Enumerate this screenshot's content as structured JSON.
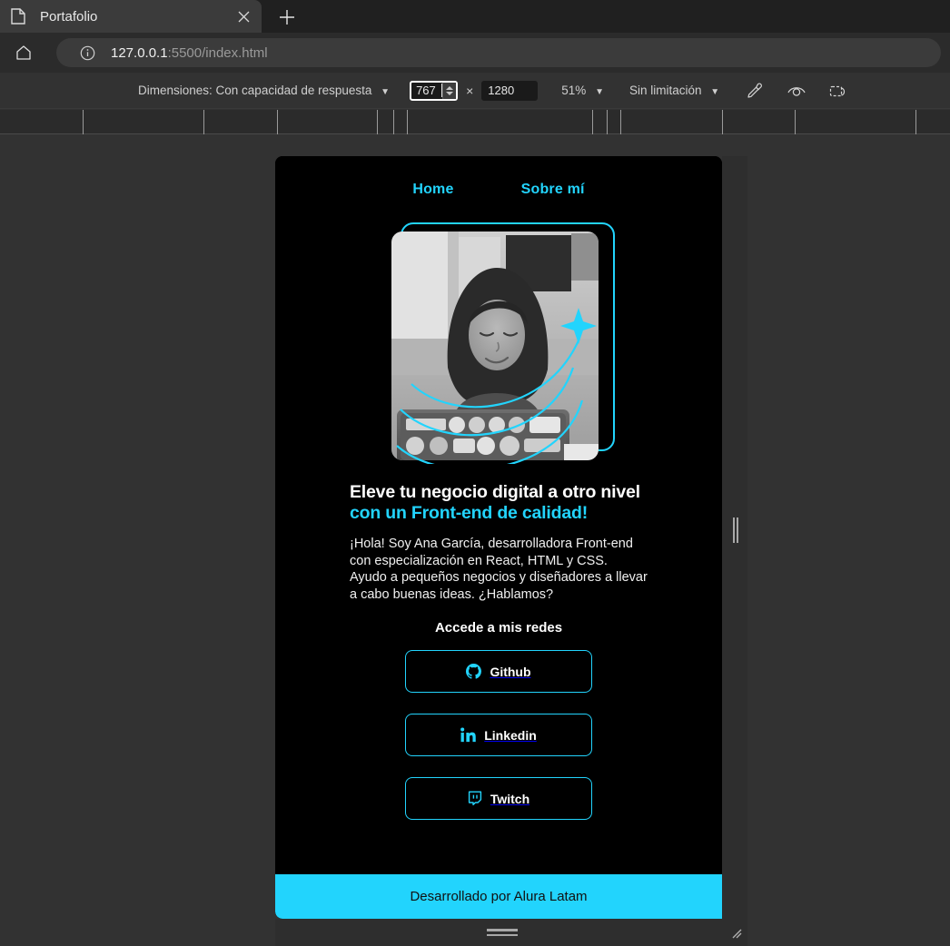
{
  "browser": {
    "tab": {
      "title": "Portafolio",
      "favicon_icon": "document-icon",
      "close_icon": "close-icon"
    },
    "new_tab_label": "+",
    "home_icon": "home-icon",
    "info_icon": "info-circle-icon",
    "url_host": "127.0.0.1",
    "url_rest": ":5500/index.html"
  },
  "device_toolbar": {
    "dimensions_label": "Dimensiones: Con capacidad de respuesta",
    "dimensions_caret": "▼",
    "width_value": "767",
    "times": "×",
    "height_value": "1280",
    "zoom_value": "51%",
    "zoom_caret": "▼",
    "throttle_value": "Sin limitación",
    "throttle_caret": "▼",
    "icons": [
      "eyedropper-icon",
      "capture-screenshot-icon",
      "more-options-icon"
    ]
  },
  "ruler": {
    "ticks": [
      91,
      224,
      305,
      415,
      433,
      448,
      652,
      668,
      683,
      795,
      875,
      1008
    ]
  },
  "page": {
    "nav": [
      {
        "label": "Home",
        "name": "nav-link-home"
      },
      {
        "label": "Sobre mí",
        "name": "nav-link-sobre-mi"
      }
    ],
    "hero": {
      "image_alt": "developer-at-laptop-photo",
      "heading_plain": "Eleve tu negocio digital a otro nivel ",
      "heading_accent": "con un Front-end de calidad!",
      "paragraph": "¡Hola! Soy Ana García, desarrolladora Front-end con especialización en React, HTML y CSS. Ayudo a pequeños negocios y diseñadores a llevar a cabo buenas ideas. ¿Hablamos?"
    },
    "social_title": "Accede a mis redes",
    "social_links": [
      {
        "label": "Github",
        "icon": "github-icon"
      },
      {
        "label": "Linkedin",
        "icon": "linkedin-icon"
      },
      {
        "label": "Twitch",
        "icon": "twitch-icon"
      }
    ],
    "footer_text": "Desarrollado por Alura Latam"
  },
  "colors": {
    "accent": "#22d4fd",
    "page_bg": "#000000",
    "chrome_bg": "#323232",
    "footer_text": "#111111"
  }
}
